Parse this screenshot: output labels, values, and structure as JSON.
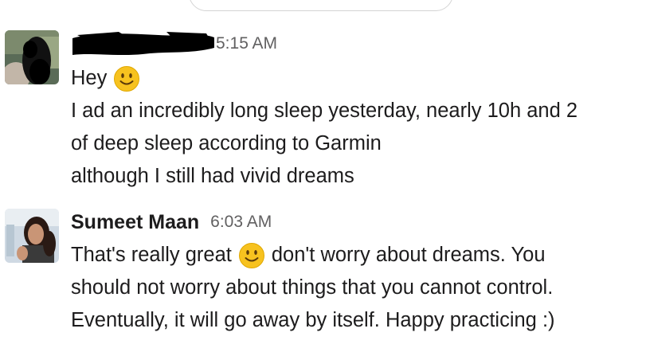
{
  "messages": [
    {
      "sender": "",
      "sender_redacted": true,
      "time": "5:15 AM",
      "lines": [
        {
          "before": "Hey",
          "emoji": "slightly-smiling-face",
          "after": ""
        },
        {
          "text": "I ad an incredibly long sleep yesterday, nearly 10h and 2"
        },
        {
          "text": "of deep sleep according to Garmin"
        },
        {
          "text": "although I still had vivid dreams"
        }
      ]
    },
    {
      "sender": "Sumeet Maan",
      "time": "6:03 AM",
      "lines": [
        {
          "before": "That's really great",
          "emoji": "slightly-smiling-face",
          "after": "don't worry about dreams. You"
        },
        {
          "text": "should not worry about things that you cannot control."
        },
        {
          "text": "Eventually, it will go away by itself. Happy practicing :)"
        }
      ]
    }
  ],
  "colors": {
    "text": "#1d1c1d",
    "timestamp": "#616061",
    "emoji_face": "#f7c21f",
    "redaction": "#000000"
  }
}
